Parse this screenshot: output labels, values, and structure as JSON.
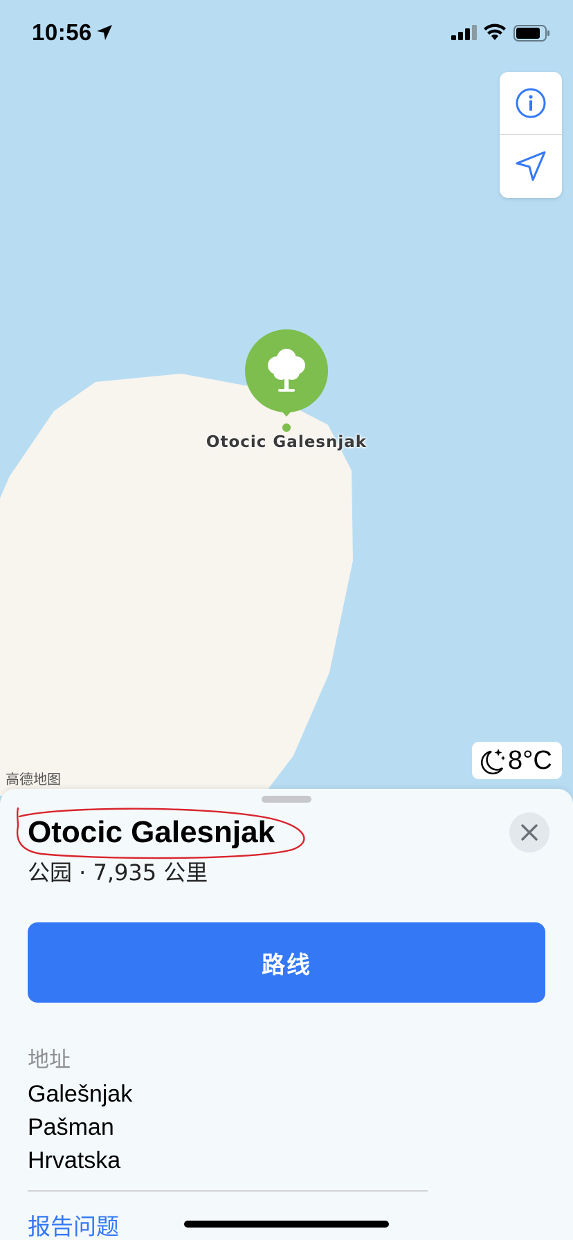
{
  "status_bar": {
    "time": "10:56"
  },
  "map": {
    "poi_label": "Otocic Galesnjak",
    "attribution": "高德地图",
    "weather_temp": "8°C",
    "colors": {
      "water": "#B8DDF3",
      "land": "#F8F4EE",
      "poi_green": "#7DBE4E"
    }
  },
  "controls": {
    "info_icon": "info-icon",
    "location_icon": "location-arrow-icon"
  },
  "sheet": {
    "title": "Otocic Galesnjak",
    "subtitle": "公园 · 7,935 公里",
    "directions_label": "路线",
    "address_label": "地址",
    "address_lines": [
      "Galešnjak",
      "Pašman",
      "Hrvatska"
    ],
    "report_label": "报告问题",
    "accent": "#3478F6"
  }
}
